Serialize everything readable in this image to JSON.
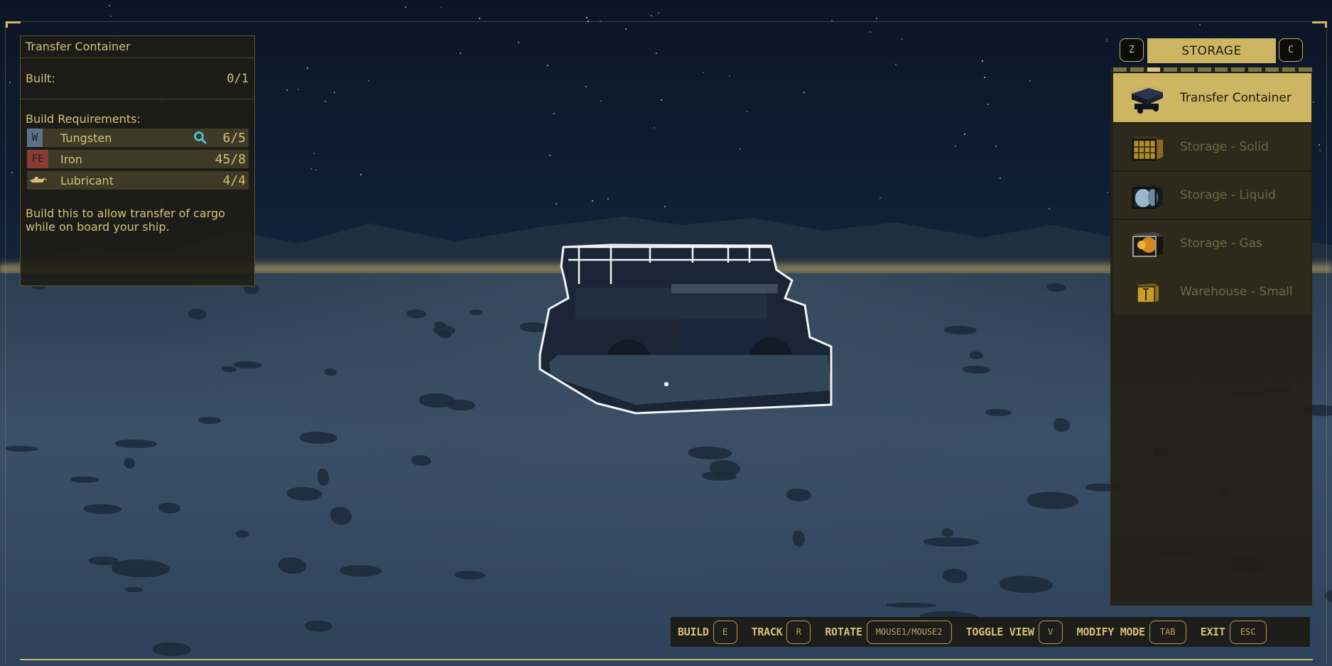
{
  "info_panel": {
    "title": "Transfer Container",
    "built_label": "Built:",
    "built_value": "0/1",
    "requirements_label": "Build Requirements:",
    "requirements": [
      {
        "badge": "W",
        "badge_color": "#5a7289",
        "name": "Tungsten",
        "tracked_search_icon": true,
        "quantity": "6/5"
      },
      {
        "badge": "FE",
        "badge_color": "#8a3c34",
        "name": "Iron",
        "tracked_search_icon": false,
        "quantity": "45/8"
      },
      {
        "badge": "oil-can-icon",
        "badge_color": "",
        "name": "Lubricant",
        "tracked_search_icon": false,
        "quantity": "4/4"
      }
    ],
    "description": "Build this to allow transfer of cargo while on board your ship."
  },
  "category": {
    "prev_key": "Z",
    "title": "STORAGE",
    "next_key": "C",
    "page_count": 12,
    "active_page": 3
  },
  "items": [
    {
      "label": "Transfer Container",
      "icon": "transfer-container-icon",
      "selected": true
    },
    {
      "label": "Storage - Solid",
      "icon": "storage-solid-icon",
      "selected": false
    },
    {
      "label": "Storage - Liquid",
      "icon": "storage-liquid-icon",
      "selected": false
    },
    {
      "label": "Storage - Gas",
      "icon": "storage-gas-icon",
      "selected": false
    },
    {
      "label": "Warehouse - Small",
      "icon": "warehouse-small-icon",
      "selected": false
    }
  ],
  "key_bar": [
    {
      "label": "BUILD",
      "key": "E"
    },
    {
      "label": "TRACK",
      "key": "R"
    },
    {
      "label": "ROTATE",
      "key": "MOUSE1/MOUSE2"
    },
    {
      "label": "TOGGLE VIEW",
      "key": "V"
    },
    {
      "label": "MODIFY MODE",
      "key": "TAB"
    },
    {
      "label": "EXIT",
      "key": "ESC"
    }
  ],
  "colors": {
    "accent": "#cdb562",
    "text": "#d6c079",
    "panel_bg": "#1e1c14",
    "disabled_text": "#6f6741",
    "outline": "#ffffff"
  }
}
